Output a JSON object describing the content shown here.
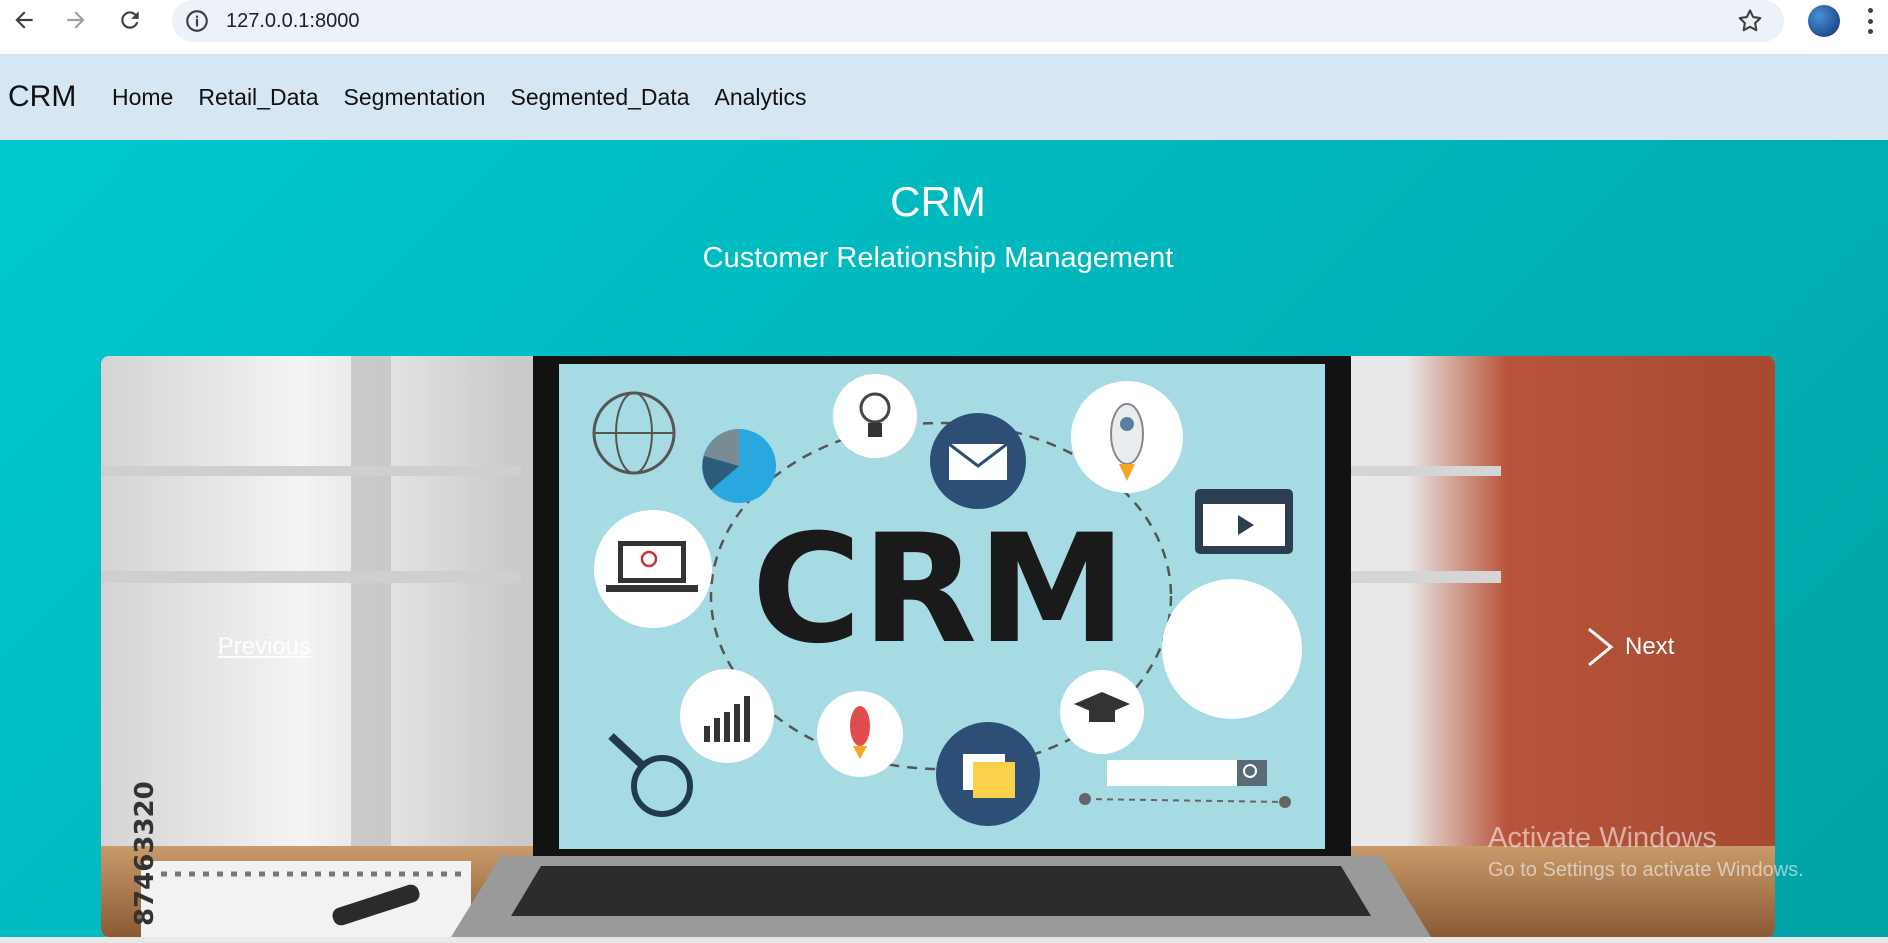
{
  "browser": {
    "url": "127.0.0.1:8000",
    "icons": [
      "back-icon",
      "forward-icon",
      "reload-icon",
      "info-icon",
      "star-icon",
      "profile-avatar",
      "menu-icon"
    ]
  },
  "navbar": {
    "brand": "CRM",
    "links": [
      "Home",
      "Retail_Data",
      "Segmentation",
      "Segmented_Data",
      "Analytics"
    ]
  },
  "hero": {
    "title": "CRM",
    "subtitle": "Customer Relationship Management"
  },
  "carousel": {
    "image_text": "CRM",
    "stock_id": "87463320",
    "prev_label": "Previous",
    "next_label": "Next"
  },
  "os_watermark": {
    "line1": "Activate Windows",
    "line2": "Go to Settings to activate Windows."
  },
  "colors": {
    "hero_bg": "#00b5ba",
    "navbar_bg": "#d6e6f2",
    "screen_bg": "#a6dbe3"
  }
}
